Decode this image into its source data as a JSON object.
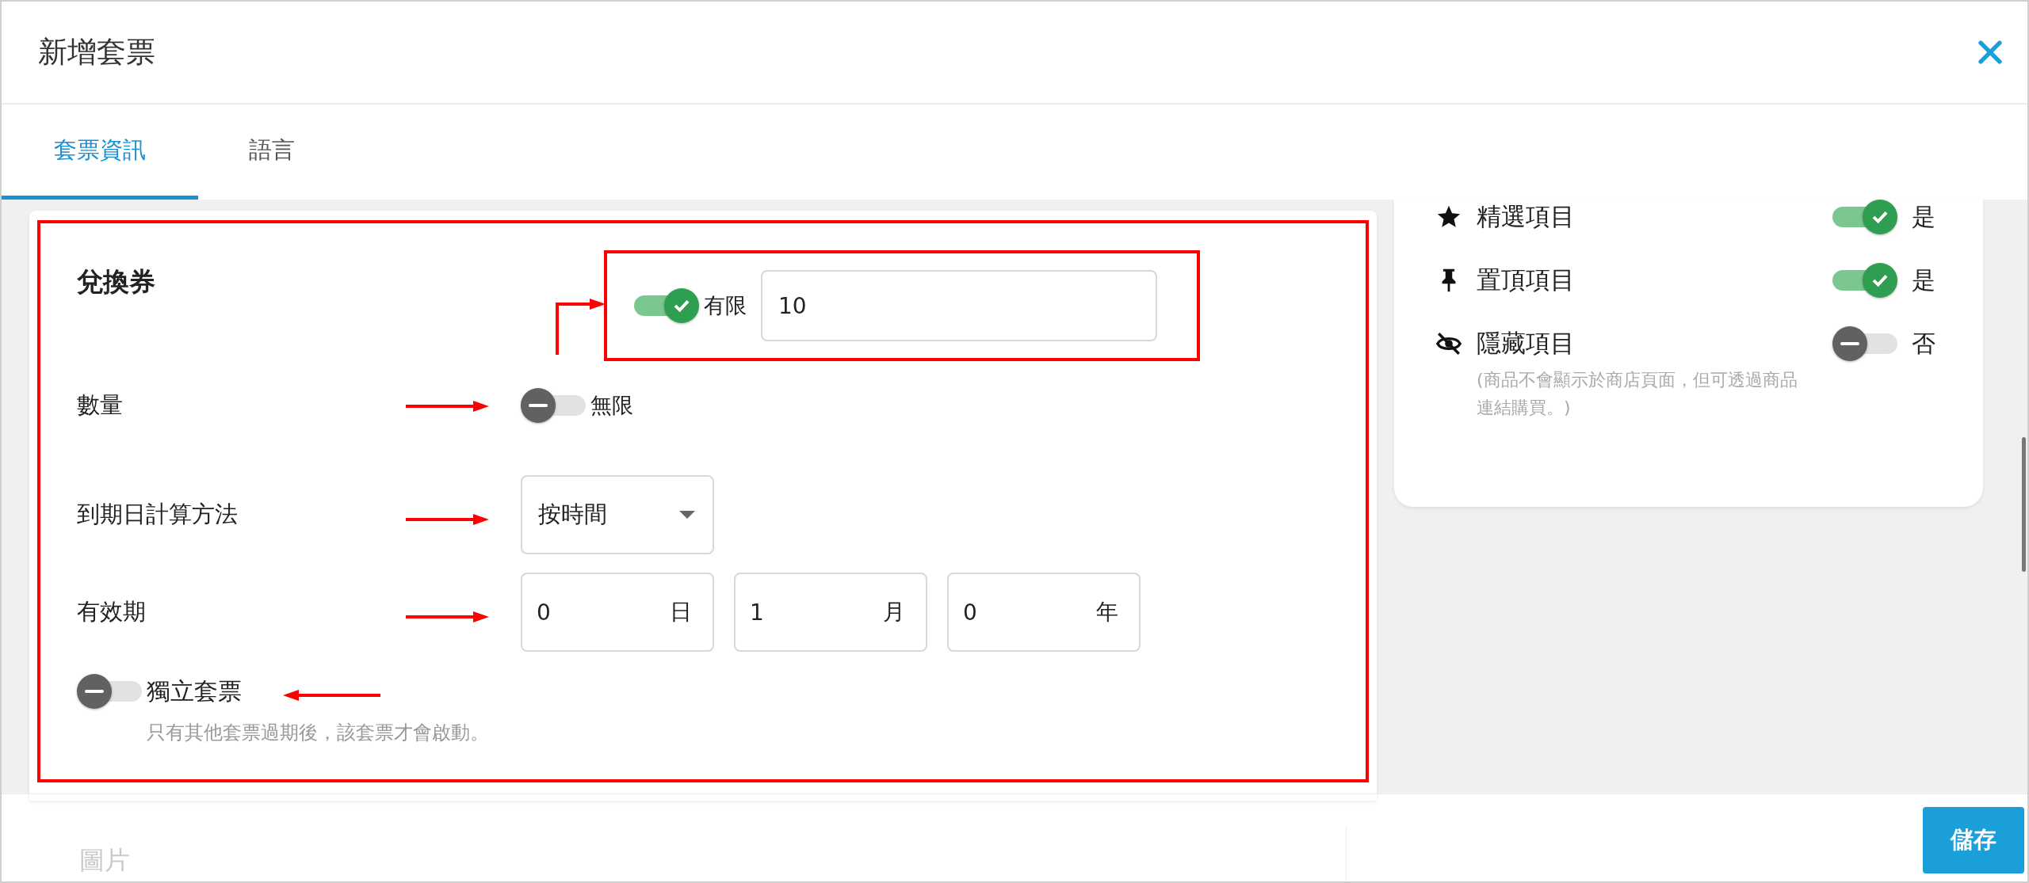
{
  "dialog": {
    "title": "新增套票"
  },
  "tabs": [
    {
      "label": "套票資訊",
      "selected": true
    },
    {
      "label": "語言",
      "selected": false
    }
  ],
  "voucher": {
    "title": "兌換券",
    "quantity": {
      "label": "數量",
      "limited": {
        "on": true,
        "label": "有限",
        "value": "10"
      },
      "unlimited": {
        "on": false,
        "label": "無限"
      }
    },
    "expiry_method": {
      "label": "到期日計算方法",
      "value": "按時間"
    },
    "validity": {
      "label": "有效期",
      "fields": [
        {
          "value": "0",
          "unit": "日"
        },
        {
          "value": "1",
          "unit": "月"
        },
        {
          "value": "0",
          "unit": "年"
        }
      ]
    },
    "standalone": {
      "on": false,
      "label": "獨立套票",
      "hint": "只有其他套票過期後，該套票才會啟動。"
    }
  },
  "flags": [
    {
      "kind": "star",
      "label": "精選項目",
      "on": true,
      "value": "是"
    },
    {
      "kind": "pin",
      "label": "置頂項目",
      "on": true,
      "value": "是"
    },
    {
      "kind": "hidden",
      "label": "隱藏項目",
      "on": false,
      "value": "否",
      "hint": "(商品不會顯示於商店頁面，但可透過商品連結購買。)"
    }
  ],
  "footer": {
    "section": "圖片",
    "save": "儲存"
  }
}
